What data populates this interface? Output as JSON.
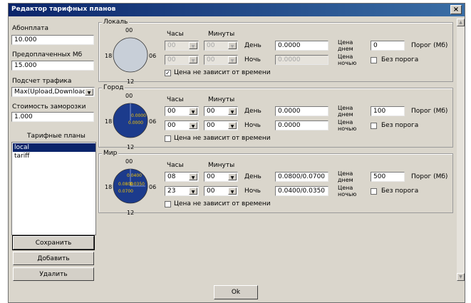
{
  "window": {
    "title": "Редактор тарифных планов",
    "close": "×"
  },
  "left": {
    "abon_label": "Абонплата",
    "abon_value": "10.000",
    "prepaid_label": "Предоплаченных Мб",
    "prepaid_value": "15.000",
    "traffic_label": "Подсчет трафика",
    "traffic_value": "Max(Upload,Download)",
    "freeze_label": "Стоимость заморозки",
    "freeze_value": "1.000",
    "plans_label": "Тарифные планы",
    "plans": [
      "local",
      "tariff"
    ],
    "buttons": {
      "save": "Сохранить",
      "add": "Добавить",
      "delete": "Удалить"
    }
  },
  "clock": {
    "top": "00",
    "left": "18",
    "right": "06",
    "bottom": "12"
  },
  "labels": {
    "hours": "Часы",
    "minutes": "Минуты",
    "day": "День",
    "night": "Ночь",
    "price_day": "Цена днем",
    "price_night": "Цена ночью",
    "threshold": "Порог (Мб)",
    "no_threshold": "Без порога",
    "time_independent": "Цена не зависит от времени"
  },
  "groups": [
    {
      "title": "Локаль",
      "day_hour": "00",
      "day_min": "00",
      "night_hour": "00",
      "night_min": "00",
      "day_price": "0.0000",
      "night_price": "0.0000",
      "threshold": "0",
      "time_independent": true,
      "pie_labels": []
    },
    {
      "title": "Город",
      "day_hour": "00",
      "day_min": "00",
      "night_hour": "00",
      "night_min": "00",
      "day_price": "0.0000",
      "night_price": "0.0000",
      "threshold": "100",
      "time_independent": false,
      "pie_labels": [
        "0.0000",
        "0.0000"
      ]
    },
    {
      "title": "Мир",
      "day_hour": "08",
      "day_min": "00",
      "night_hour": "23",
      "night_min": "00",
      "day_price": "0.0800/0.0700",
      "night_price": "0.0400/0.0350",
      "threshold": "500",
      "time_independent": false,
      "pie_labels": [
        "0.0400",
        "0.0800",
        "0.0350",
        "0.0700"
      ]
    }
  ],
  "ok": "Ok",
  "colors": {
    "titlebar": "#0a246a",
    "pie_fill": "#1c3b8c",
    "pie_empty": "#c8cfd8",
    "pie_text": "#f4c400",
    "face": "#dad6cc"
  }
}
